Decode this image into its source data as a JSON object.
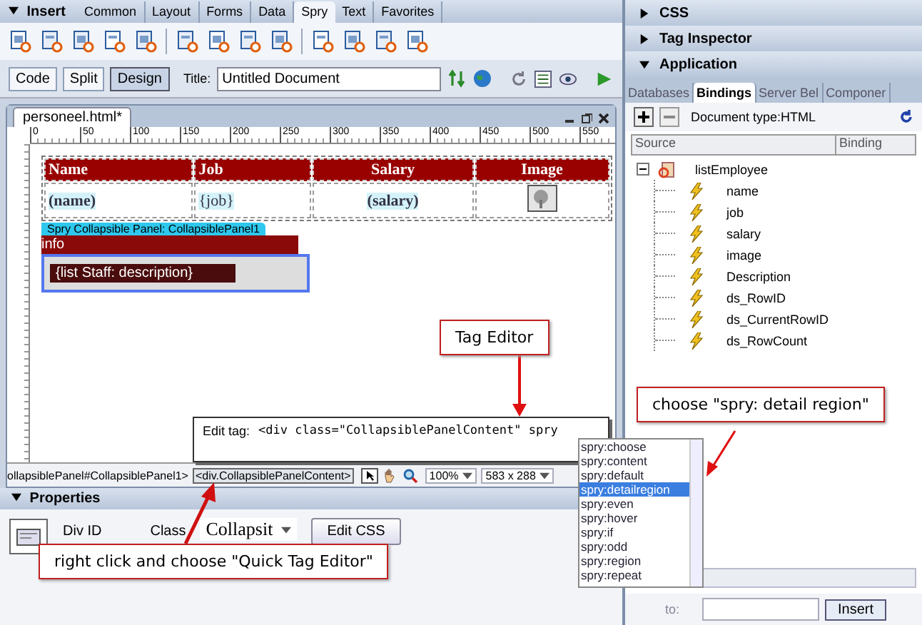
{
  "insert_bar": {
    "title": "Insert",
    "expanded": true,
    "tabs": [
      {
        "label": "Common",
        "selected": false
      },
      {
        "label": "Layout",
        "selected": false
      },
      {
        "label": "Forms",
        "selected": false
      },
      {
        "label": "Data",
        "selected": false
      },
      {
        "label": "Spry",
        "selected": true
      },
      {
        "label": "Text",
        "selected": false
      },
      {
        "label": "Favorites",
        "selected": false
      }
    ]
  },
  "document_toolbar": {
    "views": [
      {
        "label": "Code",
        "selected": false
      },
      {
        "label": "Split",
        "selected": false
      },
      {
        "label": "Design",
        "selected": true
      }
    ],
    "title_label": "Title:",
    "title_value": "Untitled Document"
  },
  "document": {
    "tab": "personeel.html*",
    "ruler_labels": [
      "0",
      "50",
      "100",
      "150",
      "200",
      "250",
      "300",
      "350",
      "400",
      "450",
      "500",
      "550"
    ],
    "table": {
      "columns": [
        "Name",
        "Job",
        "Salary",
        "Image"
      ],
      "row": [
        "(name)",
        "{job}",
        "(salary)"
      ]
    },
    "spry_label": "Spry Collapsible Panel: CollapsiblePanel1",
    "panel_tab": "info",
    "panel_content": "{list Staff: description}"
  },
  "status_bar": {
    "path": "ollapsiblePanel#CollapsiblePanel1>",
    "selected_tag": "<div.CollapsiblePanelContent>",
    "zoom": "100%",
    "size": "583 x 288"
  },
  "properties": {
    "title": "Properties",
    "expanded": true,
    "div_id_label": "Div ID",
    "class_label": "Class",
    "class_value": "Collapsit",
    "edit_css": "Edit CSS"
  },
  "tag_editor": {
    "label": "Edit tag:",
    "value": "<div class=\"CollapsiblePanelContent\" spry"
  },
  "hint_list": {
    "items": [
      {
        "label": "spry:choose",
        "selected": false
      },
      {
        "label": "spry:content",
        "selected": false
      },
      {
        "label": "spry:default",
        "selected": false
      },
      {
        "label": "spry:detailregion",
        "selected": true
      },
      {
        "label": "spry:even",
        "selected": false
      },
      {
        "label": "spry:hover",
        "selected": false
      },
      {
        "label": "spry:if",
        "selected": false
      },
      {
        "label": "spry:odd",
        "selected": false
      },
      {
        "label": "spry:region",
        "selected": false
      },
      {
        "label": "spry:repeat",
        "selected": false
      }
    ]
  },
  "callouts": [
    {
      "text": "Tag Editor"
    },
    {
      "text": "choose \"spry: detail region\""
    },
    {
      "text": "right click and choose \"Quick Tag Editor\""
    }
  ],
  "right_panel": {
    "groups": [
      {
        "title": "CSS",
        "expanded": false
      },
      {
        "title": "Tag Inspector",
        "expanded": false
      },
      {
        "title": "Application",
        "expanded": true
      }
    ],
    "tabs": [
      {
        "label": "Databases",
        "selected": false
      },
      {
        "label": "Bindings",
        "selected": true
      },
      {
        "label": "Server Bel",
        "selected": false
      },
      {
        "label": "Componer",
        "selected": false
      }
    ],
    "doc_type": "Document type:HTML",
    "columns": [
      "Source",
      "Binding"
    ],
    "tree": [
      {
        "label": "listEmployee",
        "expanded": true,
        "children": [
          {
            "label": "name"
          },
          {
            "label": "job"
          },
          {
            "label": "salary"
          },
          {
            "label": "image"
          },
          {
            "label": "Description"
          },
          {
            "label": "ds_RowID"
          },
          {
            "label": "ds_CurrentRowID"
          },
          {
            "label": "ds_RowCount"
          }
        ]
      }
    ],
    "to_label": "to:",
    "insert_button": "Insert"
  }
}
